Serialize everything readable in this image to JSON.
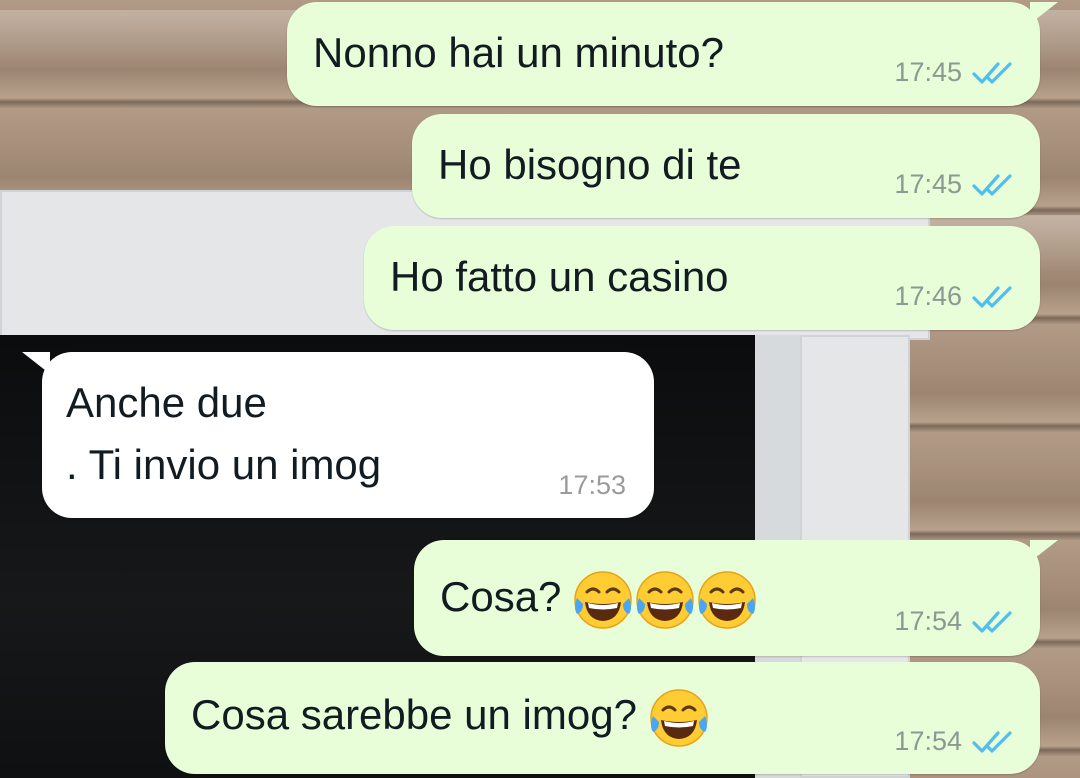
{
  "chat": {
    "messages": [
      {
        "direction": "outgoing",
        "text": "Nonno hai un minuto?",
        "time": "17:45",
        "status_icon": "double-check-read-icon"
      },
      {
        "direction": "outgoing",
        "text": "Ho bisogno di te",
        "time": "17:45",
        "status_icon": "double-check-read-icon"
      },
      {
        "direction": "outgoing",
        "text": "Ho fatto un casino",
        "time": "17:46",
        "status_icon": "double-check-read-icon"
      },
      {
        "direction": "incoming",
        "lines": [
          "Anche due",
          ". Ti invio un imog"
        ],
        "time": "17:53"
      },
      {
        "direction": "outgoing",
        "text": "Cosa?",
        "emojis": [
          "face-with-tears-of-joy-emoji",
          "face-with-tears-of-joy-emoji",
          "face-with-tears-of-joy-emoji"
        ],
        "time": "17:54",
        "status_icon": "double-check-read-icon"
      },
      {
        "direction": "outgoing",
        "text": "Cosa sarebbe un imog?",
        "emojis": [
          "face-with-tears-of-joy-emoji"
        ],
        "time": "17:54",
        "status_icon": "double-check-read-icon"
      }
    ]
  },
  "colors": {
    "outgoing_bubble": "#e7fed9",
    "incoming_bubble": "#ffffff",
    "read_ticks": "#53bdeb"
  }
}
